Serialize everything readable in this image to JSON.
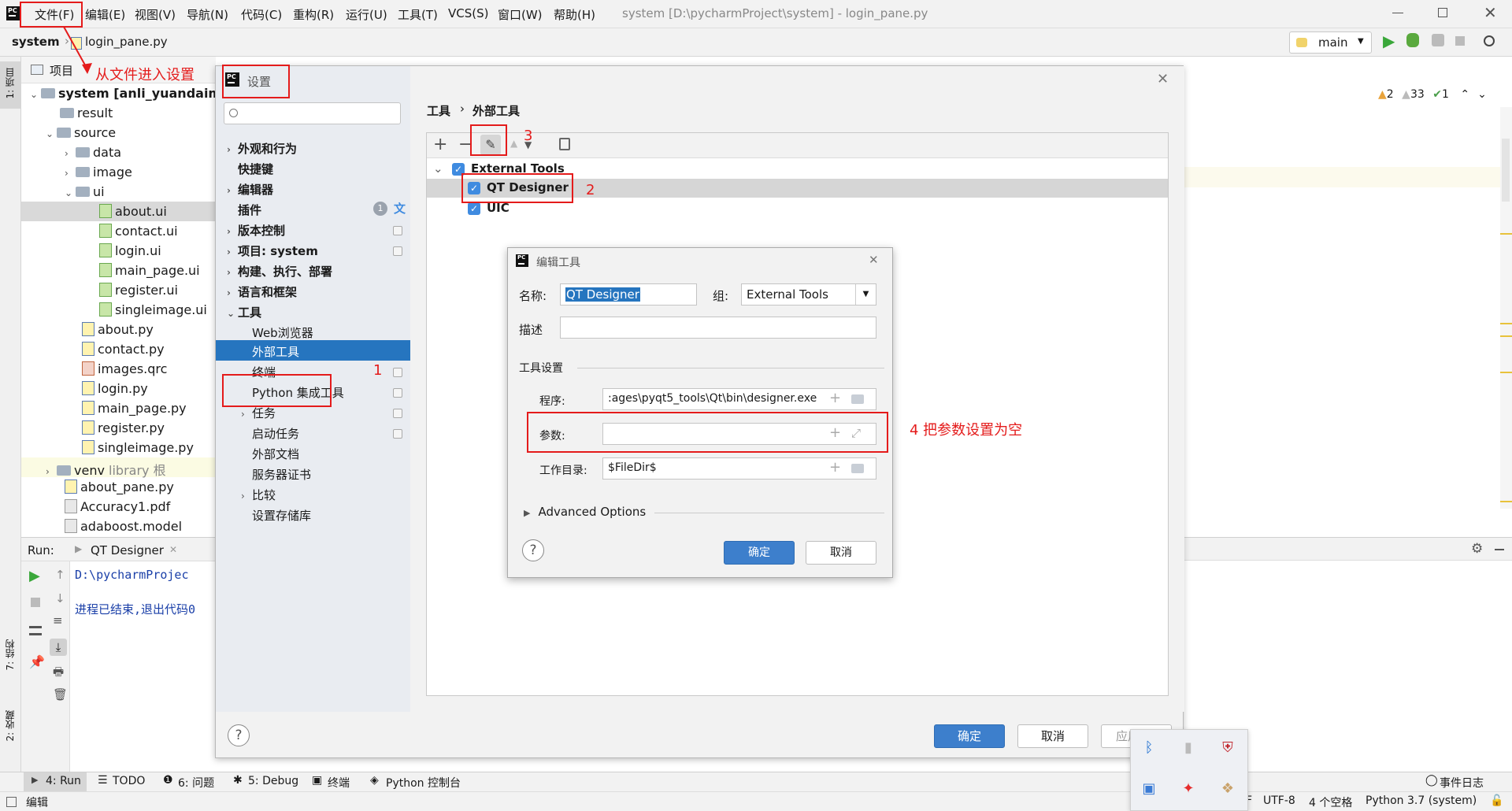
{
  "menubar": {
    "items": [
      "文件(F)",
      "编辑(E)",
      "视图(V)",
      "导航(N)",
      "代码(C)",
      "重构(R)",
      "运行(U)",
      "工具(T)",
      "VCS(S)",
      "窗口(W)",
      "帮助(H)"
    ],
    "window_title": "system [D:\\pycharmProject\\system] - login_pane.py"
  },
  "navbar": {
    "project": "system",
    "file": "login_pane.py",
    "branch": "main"
  },
  "left_strip": {
    "project_tab": "1: 项目",
    "structure_tab": "7: 结构",
    "favorites_tab": "2: 收藏"
  },
  "project_panel": {
    "header": "项目",
    "root": "system [anli_yuandaima]",
    "items": [
      {
        "name": "result"
      },
      {
        "name": "source"
      },
      {
        "name": "data"
      },
      {
        "name": "image"
      },
      {
        "name": "ui"
      },
      {
        "name": "about.ui"
      },
      {
        "name": "contact.ui"
      },
      {
        "name": "login.ui"
      },
      {
        "name": "main_page.ui"
      },
      {
        "name": "register.ui"
      },
      {
        "name": "singleimage.ui"
      },
      {
        "name": "about.py"
      },
      {
        "name": "contact.py"
      },
      {
        "name": "images.qrc"
      },
      {
        "name": "login.py"
      },
      {
        "name": "main_page.py"
      },
      {
        "name": "register.py"
      },
      {
        "name": "singleimage.py"
      },
      {
        "name": "venv",
        "suffix": "library 根"
      },
      {
        "name": "about_pane.py"
      },
      {
        "name": "Accuracy1.pdf"
      },
      {
        "name": "adaboost.model"
      }
    ]
  },
  "run_panel": {
    "label": "Run:",
    "tab": "QT Designer",
    "line1": "D:\\pycharmProjec",
    "line2": "进程已结束,退出代码0"
  },
  "bottom_tabs": [
    "4: Run",
    "TODO",
    "6: 问题",
    "5: Debug",
    "终端",
    "Python 控制台"
  ],
  "event_log": "事件日志",
  "statusbar": {
    "left": "编辑",
    "encoding_prefix": "F",
    "encoding": "UTF-8",
    "indent": "4 个空格",
    "interpreter": "Python 3.7 (system)"
  },
  "inspections": {
    "warn1": "2",
    "warn2": "33",
    "ok": "1"
  },
  "settings": {
    "title": "设置",
    "nav": [
      {
        "label": "外观和行为",
        "bold": true
      },
      {
        "label": "快捷键",
        "bold": true
      },
      {
        "label": "编辑器",
        "bold": true
      },
      {
        "label": "插件",
        "bold": true,
        "badge": "1"
      },
      {
        "label": "版本控制",
        "bold": true
      },
      {
        "label": "项目: system",
        "bold": true
      },
      {
        "label": "构建、执行、部署",
        "bold": true
      },
      {
        "label": "语言和框架",
        "bold": true
      },
      {
        "label": "工具",
        "bold": true
      },
      {
        "label": "Web浏览器"
      },
      {
        "label": "外部工具"
      },
      {
        "label": "终端"
      },
      {
        "label": "Python 集成工具"
      },
      {
        "label": "任务"
      },
      {
        "label": "启动任务"
      },
      {
        "label": "外部文档"
      },
      {
        "label": "服务器证书"
      },
      {
        "label": "比较"
      },
      {
        "label": "设置存储库"
      }
    ],
    "breadcrumb_parent": "工具",
    "breadcrumb_sep": "›",
    "breadcrumb_current": "外部工具",
    "tree_group": "External Tools",
    "tree_items": [
      "QT Designer",
      "UIC"
    ],
    "ok": "确定",
    "cancel": "取消",
    "apply": "应用(A)"
  },
  "edit_tool": {
    "title": "编辑工具",
    "name_label": "名称:",
    "name_value": "QT Designer",
    "group_label": "组:",
    "group_value": "External Tools",
    "desc_label": "描述",
    "section": "工具设置",
    "program_label": "程序:",
    "program_value": ":ages\\pyqt5_tools\\Qt\\bin\\designer.exe",
    "args_label": "参数:",
    "args_value": "",
    "workdir_label": "工作目录:",
    "workdir_value": "$FileDir$",
    "advanced": "Advanced Options",
    "ok": "确定",
    "cancel": "取消"
  },
  "annotations": {
    "a0": "从文件进入设置",
    "a1": "1",
    "a2": "2",
    "a3": "3",
    "a4": "4 把参数设置为空"
  },
  "colors": {
    "accent": "#3d7fcc",
    "selection": "#2675bf",
    "annotation": "#e41b1b"
  }
}
